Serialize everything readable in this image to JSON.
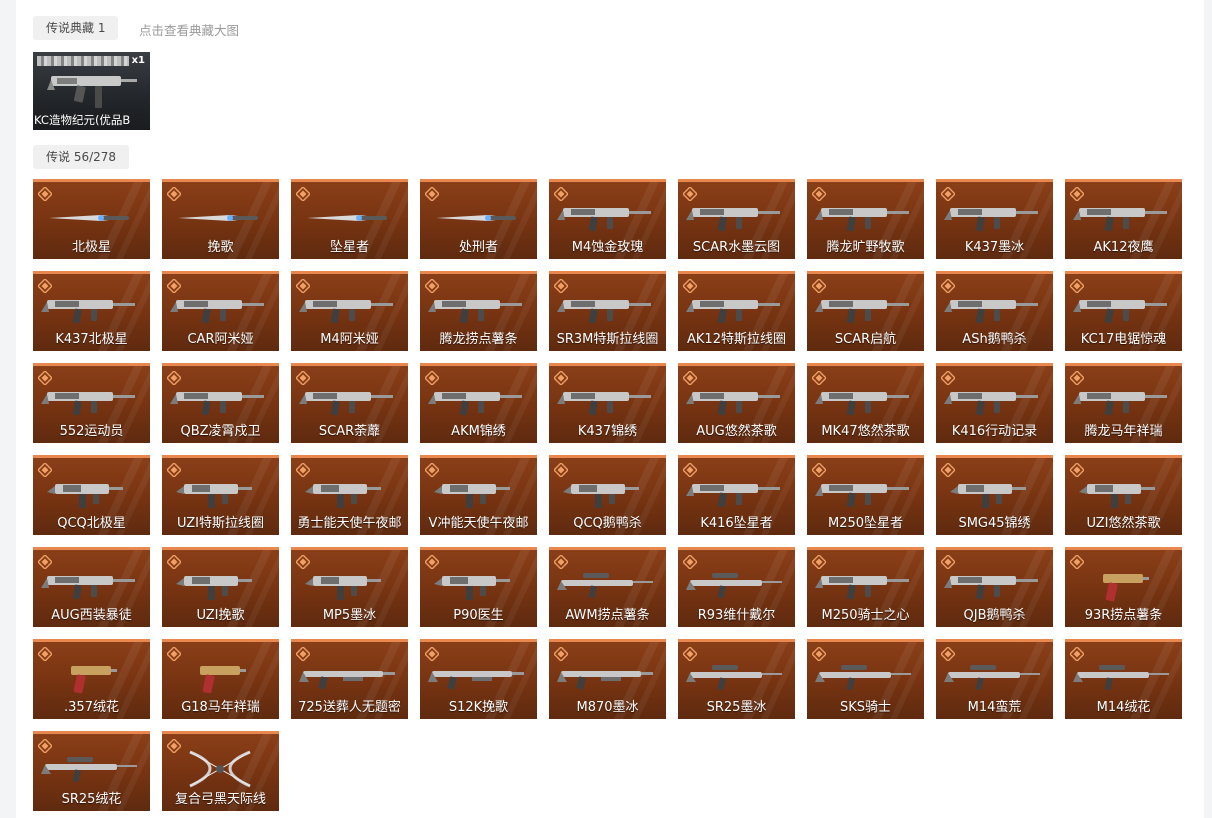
{
  "header": {
    "legend_collection_tag": "传说典藏 1",
    "view_large_link": "点击查看典藏大图",
    "legend_tag": "传说 56/278"
  },
  "special_item": {
    "name": "KC造物纪元(优品B",
    "qty": "x1"
  },
  "colors": {
    "card_top": "#8a3f18",
    "card_bottom": "#5f2a0f",
    "card_border": "#e9884e"
  },
  "items": [
    {
      "name": "北极星",
      "icon": "knife-icon"
    },
    {
      "name": "挽歌",
      "icon": "knife-icon"
    },
    {
      "name": "坠星者",
      "icon": "knife-icon"
    },
    {
      "name": "处刑者",
      "icon": "knife-icon"
    },
    {
      "name": "M4蚀金玫瑰",
      "icon": "rifle-icon"
    },
    {
      "name": "SCAR水墨云图",
      "icon": "rifle-icon"
    },
    {
      "name": "腾龙旷野牧歌",
      "icon": "rifle-icon"
    },
    {
      "name": "K437墨冰",
      "icon": "rifle-icon"
    },
    {
      "name": "AK12夜鹰",
      "icon": "rifle-icon"
    },
    {
      "name": "K437北极星",
      "icon": "rifle-icon"
    },
    {
      "name": "CAR阿米娅",
      "icon": "rifle-icon"
    },
    {
      "name": "M4阿米娅",
      "icon": "rifle-icon"
    },
    {
      "name": "腾龙捞点薯条",
      "icon": "rifle-icon"
    },
    {
      "name": "SR3M特斯拉线圈",
      "icon": "rifle-icon"
    },
    {
      "name": "AK12特斯拉线圈",
      "icon": "rifle-icon"
    },
    {
      "name": "SCAR启航",
      "icon": "rifle-icon"
    },
    {
      "name": "ASh鹅鸭杀",
      "icon": "rifle-icon"
    },
    {
      "name": "KC17电锯惊魂",
      "icon": "rifle-icon"
    },
    {
      "name": "552运动员",
      "icon": "rifle-icon"
    },
    {
      "name": "QBZ凌霄戍卫",
      "icon": "rifle-icon"
    },
    {
      "name": "SCAR荼蘼",
      "icon": "rifle-icon"
    },
    {
      "name": "AKM锦绣",
      "icon": "rifle-icon"
    },
    {
      "name": "K437锦绣",
      "icon": "rifle-icon"
    },
    {
      "name": "AUG悠然茶歌",
      "icon": "rifle-icon"
    },
    {
      "name": "MK47悠然茶歌",
      "icon": "rifle-icon"
    },
    {
      "name": "K416行动记录",
      "icon": "rifle-icon"
    },
    {
      "name": "腾龙马年祥瑞",
      "icon": "rifle-icon"
    },
    {
      "name": "QCQ北极星",
      "icon": "smg-icon"
    },
    {
      "name": "UZI特斯拉线圈",
      "icon": "smg-icon"
    },
    {
      "name": "勇士能天使午夜邮",
      "icon": "smg-icon"
    },
    {
      "name": "V冲能天使午夜邮",
      "icon": "smg-icon"
    },
    {
      "name": "QCQ鹅鸭杀",
      "icon": "smg-icon"
    },
    {
      "name": "K416坠星者",
      "icon": "rifle-icon"
    },
    {
      "name": "M250坠星者",
      "icon": "rifle-icon"
    },
    {
      "name": "SMG45锦绣",
      "icon": "smg-icon"
    },
    {
      "name": "UZI悠然茶歌",
      "icon": "smg-icon"
    },
    {
      "name": "AUG西装暴徒",
      "icon": "rifle-icon"
    },
    {
      "name": "UZI挽歌",
      "icon": "smg-icon"
    },
    {
      "name": "MP5墨冰",
      "icon": "smg-icon"
    },
    {
      "name": "P90医生",
      "icon": "smg-icon"
    },
    {
      "name": "AWM捞点薯条",
      "icon": "sniper-icon"
    },
    {
      "name": "R93维什戴尔",
      "icon": "sniper-icon"
    },
    {
      "name": "M250骑士之心",
      "icon": "rifle-icon"
    },
    {
      "name": "QJB鹅鸭杀",
      "icon": "rifle-icon"
    },
    {
      "name": "93R捞点薯条",
      "icon": "pistol-icon"
    },
    {
      "name": ".357绒花",
      "icon": "pistol-icon"
    },
    {
      "name": "G18马年祥瑞",
      "icon": "pistol-icon"
    },
    {
      "name": "725送葬人无题密",
      "icon": "shotgun-icon"
    },
    {
      "name": "S12K挽歌",
      "icon": "shotgun-icon"
    },
    {
      "name": "M870墨冰",
      "icon": "shotgun-icon"
    },
    {
      "name": "SR25墨冰",
      "icon": "sniper-icon"
    },
    {
      "name": "SKS骑士",
      "icon": "sniper-icon"
    },
    {
      "name": "M14蛮荒",
      "icon": "sniper-icon"
    },
    {
      "name": "M14绒花",
      "icon": "sniper-icon"
    },
    {
      "name": "SR25绒花",
      "icon": "sniper-icon"
    },
    {
      "name": "复合弓黑天际线",
      "icon": "bow-icon"
    }
  ]
}
